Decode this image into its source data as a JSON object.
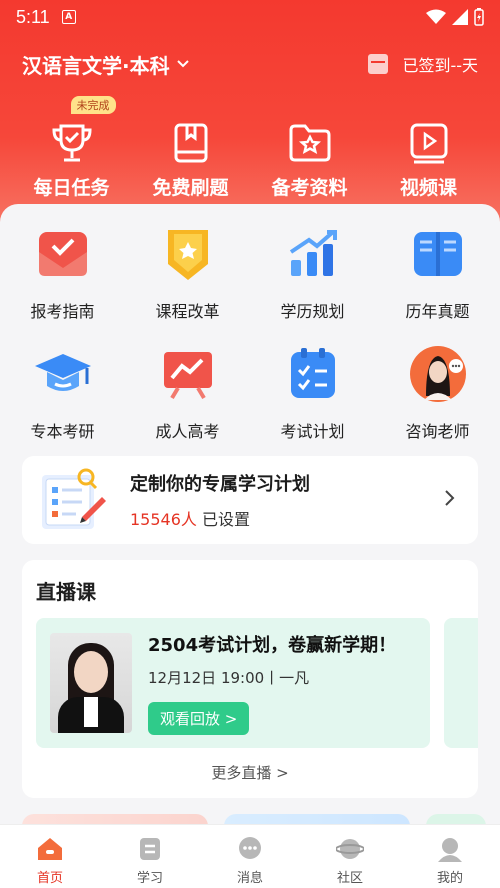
{
  "status_bar": {
    "time": "5:11",
    "notification_letter": "A"
  },
  "header": {
    "major_selector": "汉语言文学·本科",
    "checkin_text": "已签到--天"
  },
  "quick_actions": [
    {
      "label": "每日任务",
      "icon": "trophy-icon",
      "badge": "未完成"
    },
    {
      "label": "免费刷题",
      "icon": "book-icon"
    },
    {
      "label": "备考资料",
      "icon": "folder-star-icon"
    },
    {
      "label": "视频课",
      "icon": "video-play-icon"
    }
  ],
  "grid": [
    {
      "label": "报考指南",
      "icon": "envelope-check-icon",
      "color": "#f0544a"
    },
    {
      "label": "课程改革",
      "icon": "badge-star-icon",
      "color": "#f7b623"
    },
    {
      "label": "学历规划",
      "icon": "growth-chart-icon",
      "color": "#3a8bf6"
    },
    {
      "label": "历年真题",
      "icon": "open-book-icon",
      "color": "#3a8bf6"
    },
    {
      "label": "专本考研",
      "icon": "graduation-cap-icon",
      "color": "#3a8bf6"
    },
    {
      "label": "成人高考",
      "icon": "board-chart-icon",
      "color": "#f0544a"
    },
    {
      "label": "考试计划",
      "icon": "checklist-icon",
      "color": "#3a8bf6"
    },
    {
      "label": "咨询老师",
      "icon": "teacher-avatar-icon",
      "color": "#f36c3b"
    }
  ],
  "plan_card": {
    "title": "定制你的专属学习计划",
    "count": "15546人",
    "count_suffix": "已设置"
  },
  "live": {
    "section_title": "直播课",
    "item": {
      "title": "2504考试计划，卷赢新学期！",
      "time": "12月12日 19:00丨一凡",
      "replay_label": "观看回放 >"
    },
    "more_label": "更多直播 >"
  },
  "tabbar": [
    {
      "label": "首页",
      "icon": "home-icon",
      "active": true
    },
    {
      "label": "学习",
      "icon": "study-icon",
      "active": false
    },
    {
      "label": "消息",
      "icon": "message-icon",
      "active": false
    },
    {
      "label": "社区",
      "icon": "community-icon",
      "active": false
    },
    {
      "label": "我的",
      "icon": "profile-icon",
      "active": false
    }
  ],
  "colors": {
    "brand_red": "#f4392f",
    "accent_green": "#2fcb8a",
    "count_red": "#e53424"
  }
}
